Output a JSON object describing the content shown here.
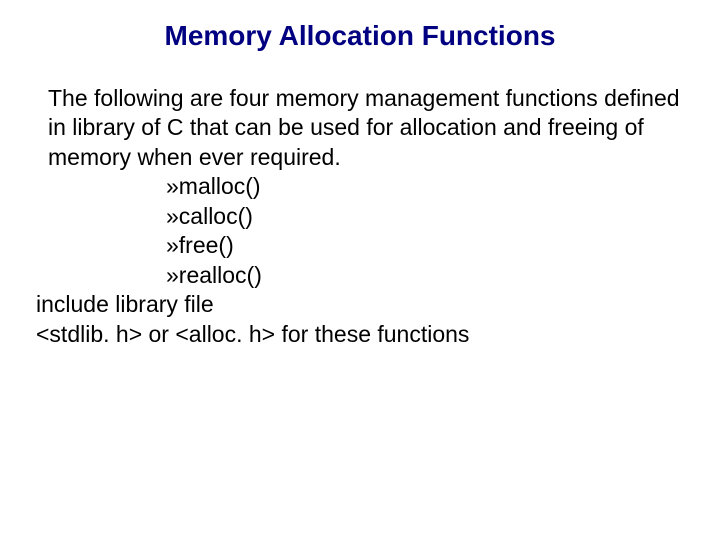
{
  "title": "Memory Allocation Functions",
  "intro": "The following are four memory management functions defined in library of C that can be used for allocation and freeing of memory when ever required.",
  "functions": {
    "bullet": "»",
    "items": [
      "malloc()",
      "calloc()",
      "free()",
      "realloc()"
    ]
  },
  "closing_line1": "include library file",
  "closing_line2": "<stdlib. h>  or <alloc. h> for these functions"
}
